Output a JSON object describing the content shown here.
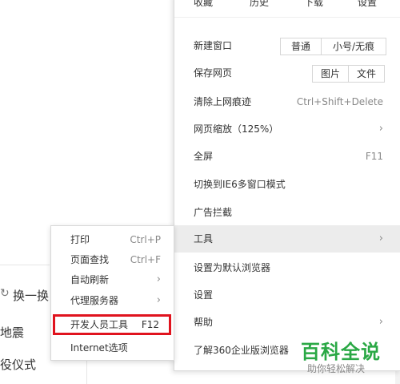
{
  "background": {
    "refresh_label": "换一换",
    "news_line1": "地震",
    "news_line2": "役仪式"
  },
  "top_row": {
    "favorites": "收藏",
    "history": "历史",
    "downloads": "下载",
    "settings": "设置"
  },
  "main_menu": {
    "new_window": {
      "label": "新建窗口",
      "buttons": [
        "普通",
        "小号/无痕"
      ]
    },
    "save_page": {
      "label": "保存网页",
      "buttons": [
        "图片",
        "文件"
      ]
    },
    "clear_traces": {
      "label": "清除上网痕迹",
      "shortcut": "Ctrl+Shift+Delete"
    },
    "zoom": {
      "label": "网页缩放（125%）",
      "arrow": "›"
    },
    "fullscreen": {
      "label": "全屏",
      "shortcut": "F11"
    },
    "ie6_mode": {
      "label": "切换到IE6多窗口模式"
    },
    "ad_block": {
      "label": "广告拦截"
    },
    "tools": {
      "label": "工具",
      "arrow": "›"
    },
    "set_default": {
      "label": "设置为默认浏览器"
    },
    "settings": {
      "label": "设置"
    },
    "help": {
      "label": "帮助",
      "arrow": "›"
    },
    "enterprise": {
      "label": "了解360企业版浏览器"
    }
  },
  "sub_menu": {
    "print": {
      "label": "打印",
      "shortcut": "Ctrl+P"
    },
    "find": {
      "label": "页面查找",
      "shortcut": "Ctrl+F"
    },
    "auto_refresh": {
      "label": "自动刷新",
      "arrow": "›"
    },
    "proxy": {
      "label": "代理服务器",
      "arrow": "›"
    },
    "devtools": {
      "label": "开发人员工具",
      "shortcut": "F12"
    },
    "internet_options": {
      "label": "Internet选项"
    }
  },
  "watermark": {
    "title": "百科全说",
    "subtitle": "助你轻松解决"
  },
  "colors": {
    "highlight_box": "#e0131e",
    "watermark_green": "#2aa845",
    "menu_hover": "#ececec"
  }
}
